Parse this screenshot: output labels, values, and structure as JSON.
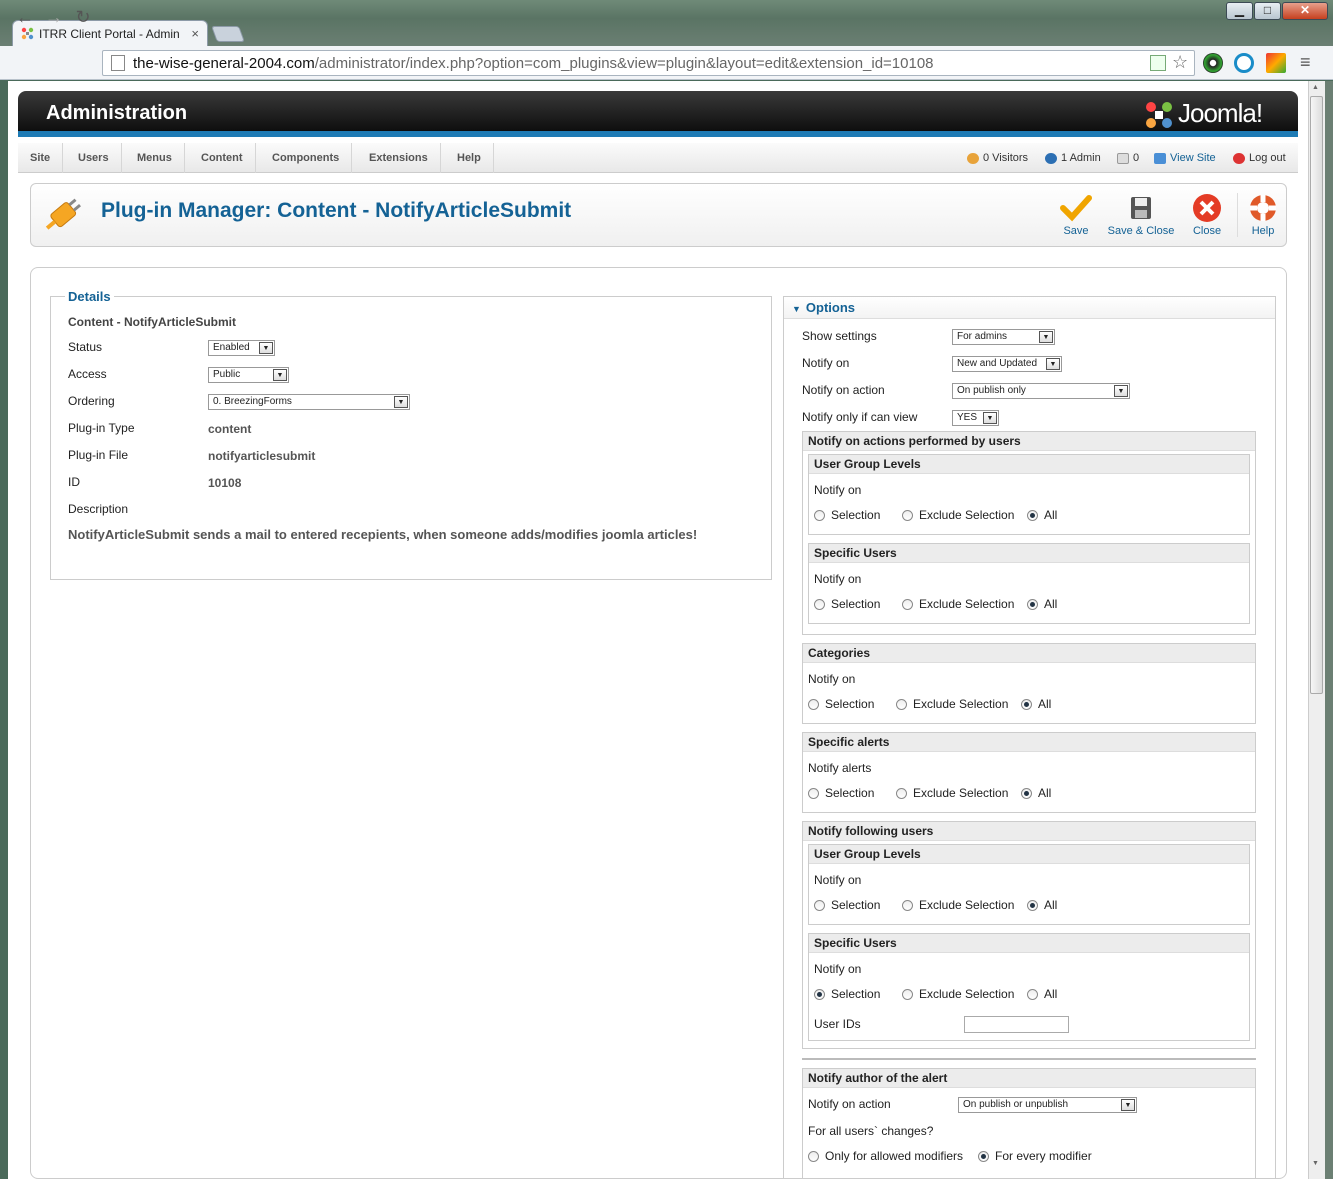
{
  "browser": {
    "tab_title": "ITRR Client Portal - Admin",
    "tab_close": "×",
    "url_host": "the-wise-general-2004.com",
    "url_path": "/administrator/index.php?option=com_plugins&view=plugin&layout=edit&extension_id=10108",
    "window": {
      "min": "▁",
      "max": "□",
      "close": "✕"
    }
  },
  "header": {
    "title": "Administration",
    "logo_text": "Joomla!"
  },
  "menu": {
    "items": [
      "Site",
      "Users",
      "Menus",
      "Content",
      "Components",
      "Extensions",
      "Help"
    ],
    "status": {
      "visitors": "0 Visitors",
      "admin": "1 Admin",
      "messages": "0",
      "view_site": "View Site",
      "logout": "Log out"
    }
  },
  "page": {
    "title": "Plug-in Manager: Content - NotifyArticleSubmit"
  },
  "toolbar": {
    "save": "Save",
    "save_close": "Save & Close",
    "close": "Close",
    "help": "Help"
  },
  "details": {
    "legend": "Details",
    "name": "Content - NotifyArticleSubmit",
    "status_label": "Status",
    "status_value": "Enabled",
    "access_label": "Access",
    "access_value": "Public",
    "ordering_label": "Ordering",
    "ordering_value": "0. BreezingForms",
    "type_label": "Plug-in Type",
    "type_value": "content",
    "file_label": "Plug-in File",
    "file_value": "notifyarticlesubmit",
    "id_label": "ID",
    "id_value": "10108",
    "desc_label": "Description",
    "desc_value": "NotifyArticleSubmit sends a mail to entered recepients, when someone adds/modifies joomla articles!"
  },
  "options": {
    "title": "Options",
    "show_settings_label": "Show settings",
    "show_settings_value": "For admins",
    "notify_on_label": "Notify on",
    "notify_on_value": "New and Updated",
    "notify_action_label": "Notify on action",
    "notify_action_value": "On publish only",
    "notify_view_label": "Notify only if can view",
    "notify_view_value": "YES",
    "radio_selection": "Selection",
    "radio_exclude": "Exclude Selection",
    "radio_all": "All",
    "performed": {
      "title": "Notify on actions performed by users",
      "ugl": {
        "title": "User Group Levels",
        "label": "Notify on"
      },
      "su": {
        "title": "Specific Users",
        "label": "Notify on"
      }
    },
    "categories": {
      "title": "Categories",
      "label": "Notify on"
    },
    "alerts": {
      "title": "Specific alerts",
      "label": "Notify alerts"
    },
    "following": {
      "title": "Notify following users",
      "ugl": {
        "title": "User Group Levels",
        "label": "Notify on"
      },
      "su": {
        "title": "Specific Users",
        "label": "Notify on",
        "userids_label": "User IDs"
      }
    },
    "author": {
      "title": "Notify author of the alert",
      "action_label": "Notify on action",
      "action_value": "On publish or unpublish",
      "changes_label": "For all users` changes?",
      "only_allowed": "Only for allowed modifiers",
      "every_modifier": "For every modifier"
    }
  },
  "colors": {
    "accent": "#146295",
    "header_bar": "#1e7bb5"
  }
}
